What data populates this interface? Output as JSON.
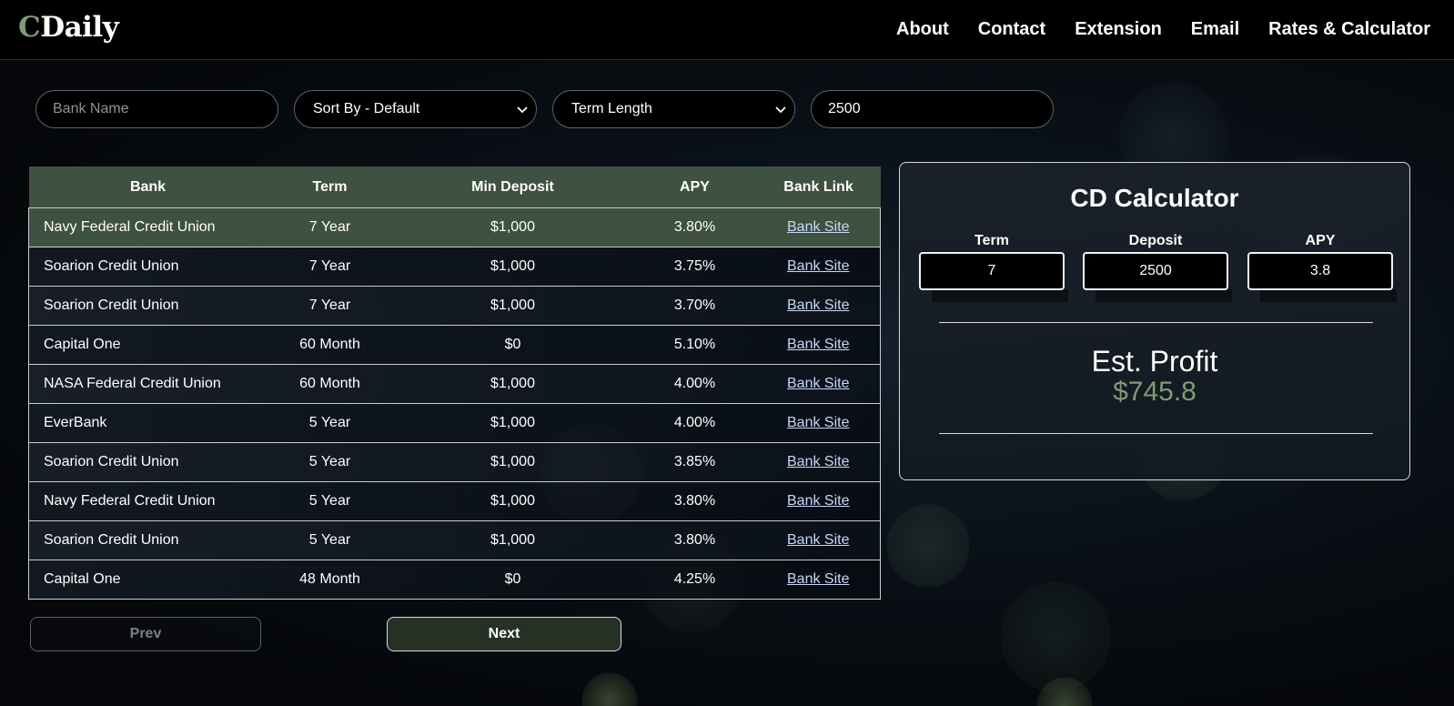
{
  "header": {
    "logo_first": "C",
    "logo_rest": "Daily",
    "nav": [
      "About",
      "Contact",
      "Extension",
      "Email",
      "Rates & Calculator"
    ]
  },
  "filters": {
    "bank_name_placeholder": "Bank Name",
    "sort_by": "Sort By - Default",
    "term_length": "Term Length",
    "deposit_value": "2500"
  },
  "table": {
    "headers": [
      "Bank",
      "Term",
      "Min Deposit",
      "APY",
      "Bank Link"
    ],
    "rows": [
      {
        "bank": "Navy Federal Credit Union",
        "term": "7 Year",
        "min_deposit": "$1,000",
        "apy": "3.80%",
        "link": "Bank Site"
      },
      {
        "bank": "Soarion Credit Union",
        "term": "7 Year",
        "min_deposit": "$1,000",
        "apy": "3.75%",
        "link": "Bank Site"
      },
      {
        "bank": "Soarion Credit Union",
        "term": "7 Year",
        "min_deposit": "$1,000",
        "apy": "3.70%",
        "link": "Bank Site"
      },
      {
        "bank": "Capital One",
        "term": "60 Month",
        "min_deposit": "$0",
        "apy": "5.10%",
        "link": "Bank Site"
      },
      {
        "bank": "NASA Federal Credit Union",
        "term": "60 Month",
        "min_deposit": "$1,000",
        "apy": "4.00%",
        "link": "Bank Site"
      },
      {
        "bank": "EverBank",
        "term": "5 Year",
        "min_deposit": "$1,000",
        "apy": "4.00%",
        "link": "Bank Site"
      },
      {
        "bank": "Soarion Credit Union",
        "term": "5 Year",
        "min_deposit": "$1,000",
        "apy": "3.85%",
        "link": "Bank Site"
      },
      {
        "bank": "Navy Federal Credit Union",
        "term": "5 Year",
        "min_deposit": "$1,000",
        "apy": "3.80%",
        "link": "Bank Site"
      },
      {
        "bank": "Soarion Credit Union",
        "term": "5 Year",
        "min_deposit": "$1,000",
        "apy": "3.80%",
        "link": "Bank Site"
      },
      {
        "bank": "Capital One",
        "term": "48 Month",
        "min_deposit": "$0",
        "apy": "4.25%",
        "link": "Bank Site"
      }
    ]
  },
  "pager": {
    "prev": "Prev",
    "next": "Next"
  },
  "calculator": {
    "title": "CD Calculator",
    "term_label": "Term",
    "term_value": "7",
    "deposit_label": "Deposit",
    "deposit_value": "2500",
    "apy_label": "APY",
    "apy_value": "3.8",
    "profit_label": "Est. Profit",
    "profit_value": "$745.8"
  },
  "colors": {
    "accent_green": "#7f9c74",
    "table_header_bg": "#3f5140",
    "link": "#c5d8f7"
  }
}
